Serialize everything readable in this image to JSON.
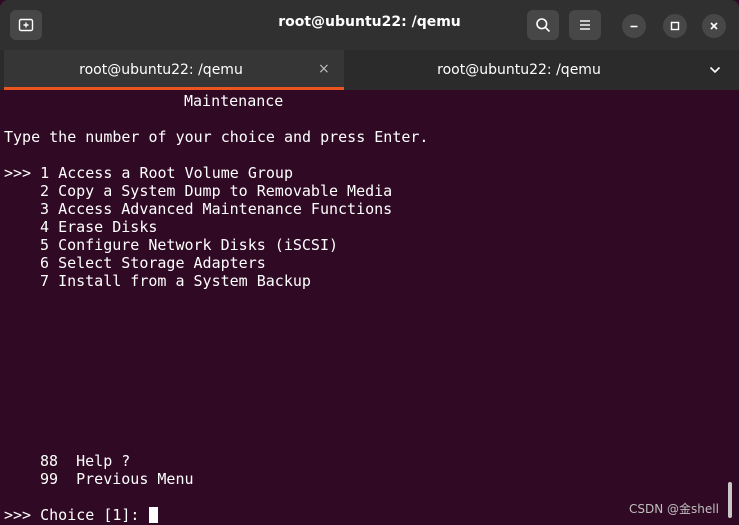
{
  "window": {
    "title": "root@ubuntu22: /qemu"
  },
  "titlebar": {
    "new_tab_icon": "new-tab-icon",
    "search_icon": "search-icon",
    "menu_icon": "hamburger-menu-icon",
    "minimize_icon": "minimize-icon",
    "maximize_icon": "maximize-icon",
    "close_icon": "close-icon"
  },
  "tabs": [
    {
      "label": "root@ubuntu22: /qemu",
      "active": true,
      "close": "×"
    },
    {
      "label": "root@ubuntu22: /qemu",
      "active": false,
      "close": "×"
    }
  ],
  "terminal": {
    "heading": "Maintenance",
    "instruction": "Type the number of your choice and press Enter.",
    "prompt_marker": ">>>",
    "options": [
      {
        "number": "1",
        "label": "Access a Root Volume Group"
      },
      {
        "number": "2",
        "label": "Copy a System Dump to Removable Media"
      },
      {
        "number": "3",
        "label": "Access Advanced Maintenance Functions"
      },
      {
        "number": "4",
        "label": "Erase Disks"
      },
      {
        "number": "5",
        "label": "Configure Network Disks (iSCSI)"
      },
      {
        "number": "6",
        "label": "Select Storage Adapters"
      },
      {
        "number": "7",
        "label": "Install from a System Backup"
      }
    ],
    "extra_options": [
      {
        "number": "88",
        "label": "Help ?"
      },
      {
        "number": "99",
        "label": "Previous Menu"
      }
    ],
    "choice_prompt": ">>> Choice [1]: "
  },
  "watermark": "CSDN @金shell",
  "colors": {
    "terminal_bg": "#300a24",
    "accent": "#e95420",
    "titlebar_bg": "#303030"
  }
}
